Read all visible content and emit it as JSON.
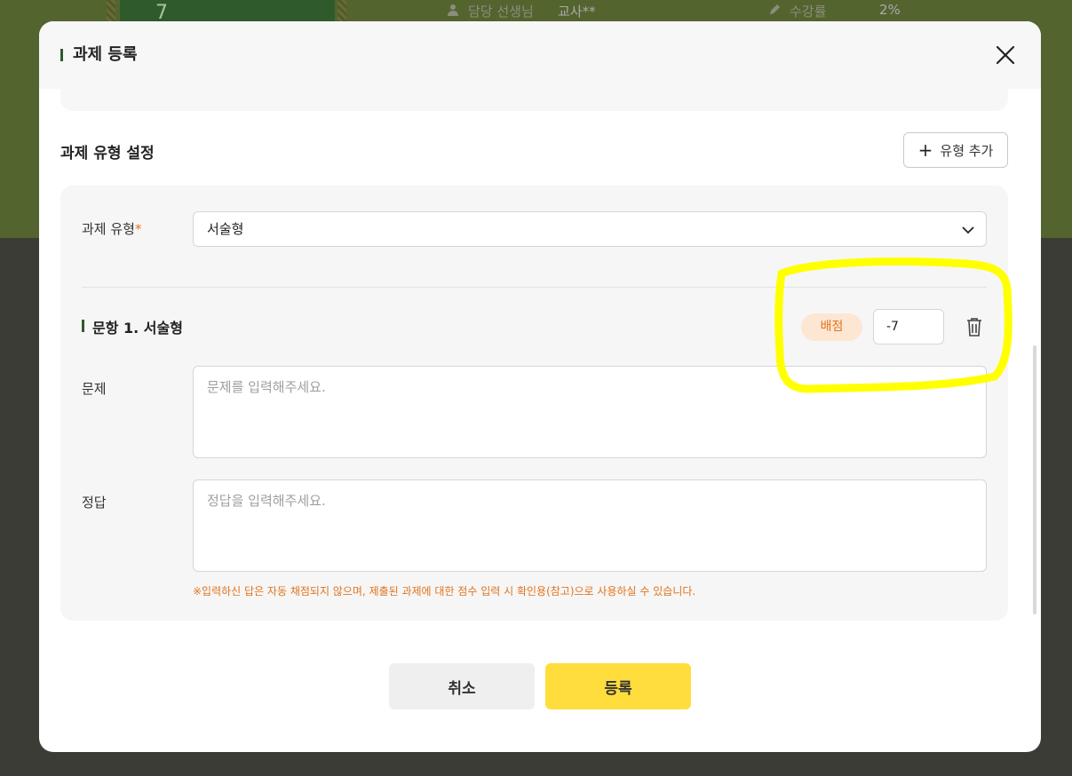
{
  "background": {
    "hero_number": "7",
    "teacher_label": "담당 선생님",
    "teacher_value": "교사**",
    "progress_label": "수강률",
    "progress_value": "2%"
  },
  "modal": {
    "title": "과제 등록",
    "section_title": "과제 유형 설정",
    "add_type_label": "유형 추가",
    "type_field": {
      "label": "과제 유형",
      "required_mark": "*",
      "selected": "서술형"
    },
    "question": {
      "title": "문항 1. 서술형",
      "score_label": "배점",
      "score_value": "-7",
      "problem_label": "문제",
      "problem_placeholder": "문제를 입력해주세요.",
      "answer_label": "정답",
      "answer_placeholder": "정답을 입력해주세요.",
      "notice": "※입력하신 답은 자동 채점되지 않으며, 제출된 과제에 대한 점수 입력 시 확인용(참고)으로 사용하실 수 있습니다."
    },
    "cancel_label": "취소",
    "submit_label": "등록"
  },
  "colors": {
    "accent_yellow": "#ffdd3c",
    "accent_orange": "#e0741f",
    "brand_green": "#2f5b2c",
    "highlight": "#ffff00"
  },
  "icons": {
    "close": "close-icon",
    "plus": "plus-icon",
    "chevron": "chevron-down-icon",
    "trash": "trash-icon",
    "person": "person-icon",
    "pencil": "pencil-icon"
  }
}
